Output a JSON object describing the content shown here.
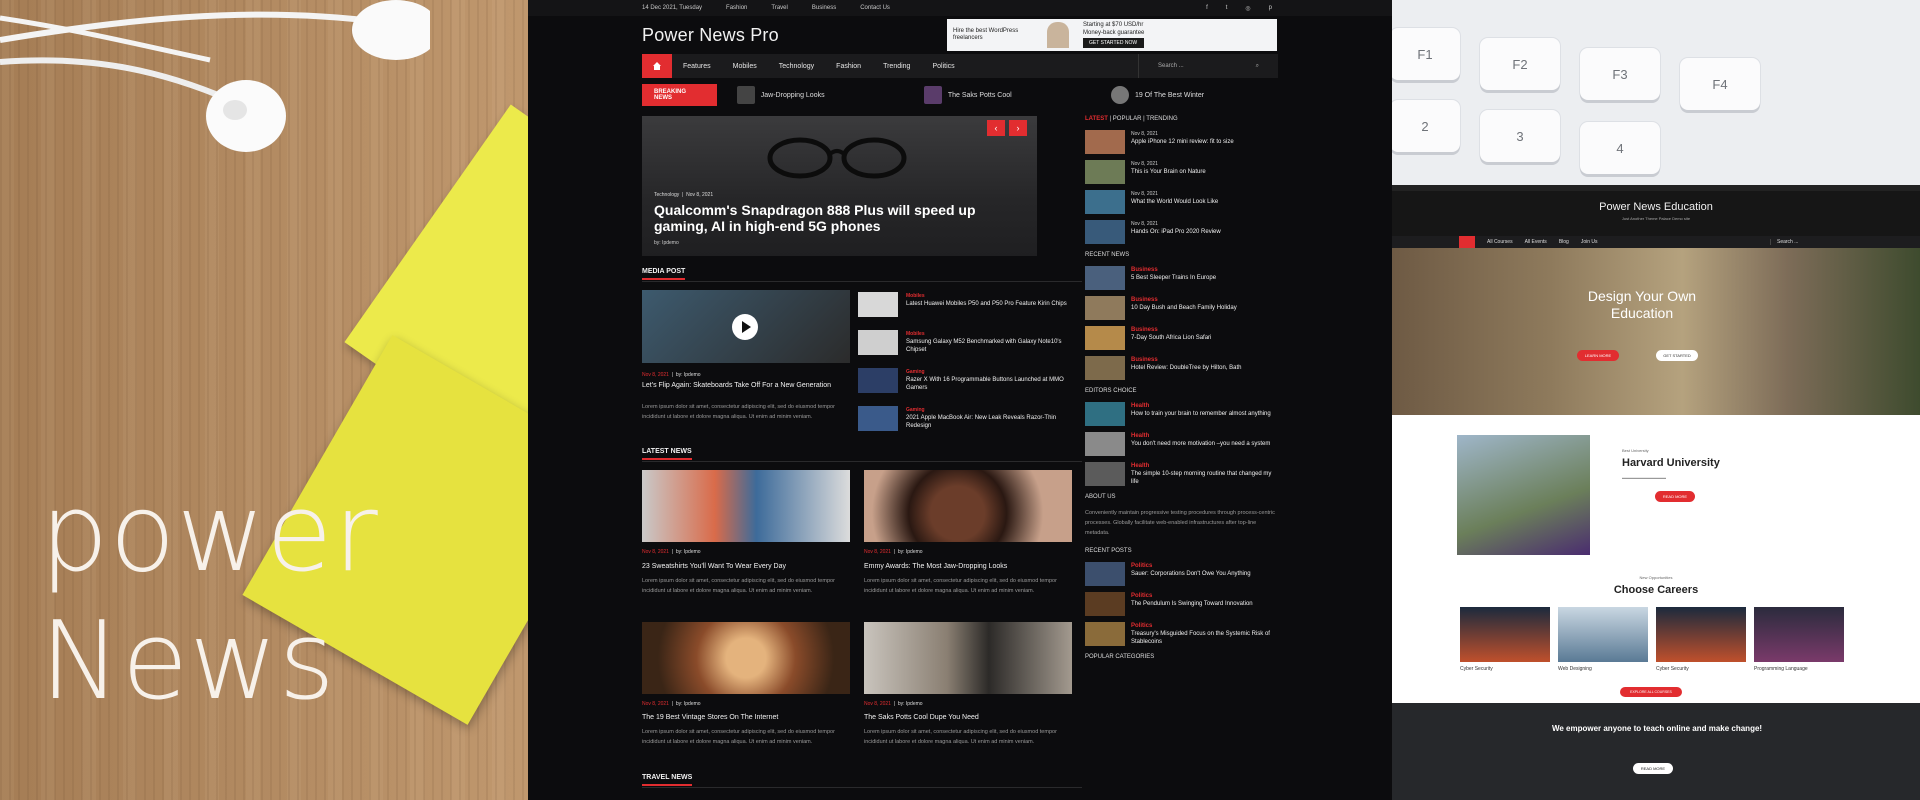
{
  "background": {
    "word1": "power",
    "word2": "News"
  },
  "keyboard": {
    "keys": [
      "F1",
      "F2",
      "F3",
      "F4",
      "2",
      "3",
      "4"
    ]
  },
  "main_site": {
    "topbar": {
      "date": "14 Dec 2021, Tuesday",
      "links": [
        "Fashion",
        "Travel",
        "Business",
        "Contact Us"
      ],
      "social_icons": [
        "facebook-icon",
        "twitter-icon",
        "instagram-icon",
        "pinterest-icon"
      ]
    },
    "logo": "Power News Pro",
    "ad": {
      "headline": "Hire the best WordPress freelancers",
      "rating": "Starting at $70 USD/hr",
      "guarantee": "Money-back guarantee",
      "button": "GET STARTED NOW"
    },
    "nav": {
      "items": [
        "Features",
        "Mobiles",
        "Technology",
        "Fashion",
        "Trending",
        "Politics"
      ],
      "search_placeholder": "Search ..."
    },
    "ticker": {
      "label": "BREAKING NEWS",
      "items": [
        "Jaw-Dropping Looks",
        "The Saks Potts Cool",
        "19 Of The Best Winter"
      ]
    },
    "hero": {
      "category": "Technology",
      "date": "Nov 8, 2021",
      "title": "Qualcomm's Snapdragon 888 Plus will speed up gaming, AI in high-end 5G phones",
      "author": "by: Ipdemo"
    },
    "sections": {
      "media": "MEDIA POST",
      "latest": "LATEST NEWS",
      "travel": "TRAVEL NEWS"
    },
    "media_post": {
      "main_date": "Nov 8, 2021",
      "main_author": "by: Ipdemo",
      "main_title": "Let's Flip Again: Skateboards Take Off For a New Generation",
      "lorem": "Lorem ipsum dolor sit amet, consectetur adipiscing elit, sed do eiusmod tempor incididunt ut labore et dolore magna aliqua. Ut enim ad minim veniam.",
      "list": [
        {
          "cat": "Mobiles",
          "title": "Latest Huawei Mobiles P50 and P50 Pro Feature Kirin Chips"
        },
        {
          "cat": "Mobiles",
          "title": "Samsung Galaxy M52 Benchmarked with Galaxy Note10's Chipset"
        },
        {
          "cat": "Gaming",
          "title": "Razer X With 16 Programmable Buttons Launched at MMO Gamers"
        },
        {
          "cat": "Gaming",
          "title": "2021 Apple MacBook Air: New Leak Reveals Razor-Thin Redesign"
        }
      ]
    },
    "latest_news": [
      {
        "date": "Nov 8, 2021",
        "author": "by: Ipdemo",
        "title": "23 Sweatshirts You'll Want To Wear Every Day"
      },
      {
        "date": "Nov 8, 2021",
        "author": "by: Ipdemo",
        "title": "Emmy Awards: The Most Jaw-Dropping Looks"
      },
      {
        "date": "Nov 8, 2021",
        "author": "by: Ipdemo",
        "title": "The 19 Best Vintage Stores On The Internet"
      },
      {
        "date": "Nov 8, 2021",
        "author": "by: Ipdemo",
        "title": "The Saks Potts Cool Dupe You Need"
      }
    ],
    "sidebar": {
      "tabs": [
        "LATEST",
        "POPULAR",
        "TRENDING"
      ],
      "latest": [
        {
          "date": "Nov 8, 2021",
          "title": "Apple iPhone 12 mini review: fit to size"
        },
        {
          "date": "Nov 8, 2021",
          "title": "This is Your Brain on Nature"
        },
        {
          "date": "Nov 8, 2021",
          "title": "What the World Would Look Like"
        },
        {
          "date": "Nov 8, 2021",
          "title": "Hands On: iPad Pro 2020 Review"
        }
      ],
      "recent_news_title": "RECENT NEWS",
      "recent_news": [
        {
          "cat": "Business",
          "title": "5 Best Sleeper Trains In Europe"
        },
        {
          "cat": "Business",
          "title": "10 Day Bush and Beach Family Holiday"
        },
        {
          "cat": "Business",
          "title": "7-Day South Africa Lion Safari"
        },
        {
          "cat": "Business",
          "title": "Hotel Review: DoubleTree by Hilton, Bath"
        }
      ],
      "editors_title": "EDITORS CHOICE",
      "editors": [
        {
          "cat": "Health",
          "title": "How to train your brain to remember almost anything"
        },
        {
          "cat": "Health",
          "title": "You don't need more motivation –you need a system"
        },
        {
          "cat": "Health",
          "title": "The simple 10-step morning routine that changed my life"
        }
      ],
      "about_title": "ABOUT US",
      "about_text": "Conveniently maintain progressive testing procedures through process-centric processes. Globally facilitate web-enabled infrastructures after top-line metadata.",
      "recent_posts_title": "RECENT POSTS",
      "recent_posts": [
        {
          "cat": "Politics",
          "title": "Sauer: Corporations Don't Owe You Anything"
        },
        {
          "cat": "Politics",
          "title": "The Pendulum Is Swinging Toward Innovation"
        },
        {
          "cat": "Politics",
          "title": "Treasury's Misguided Focus on the Systemic Risk of Stablecoins"
        }
      ],
      "popular_title": "POPULAR CATEGORIES"
    }
  },
  "edu_site": {
    "title": "Power News Education",
    "subtitle": "Just Another Theme Palace Demo site",
    "nav": [
      "All Courses",
      "All Events",
      "Blog",
      "Join Us"
    ],
    "search_placeholder": "Search ...",
    "hero_title": "Design Your Own Education",
    "hero_btn1": "LEARN MORE",
    "hero_btn2": "GET STARTED",
    "uni_small": "Best University",
    "uni_title": "Harvard University",
    "uni_btn": "READ MORE",
    "careers_small": "New Opportunities",
    "careers_title": "Choose Careers",
    "careers": [
      "Cyber Security",
      "Web Designing",
      "Cyber Security",
      "Programming Language"
    ],
    "careers_btn": "EXPLORE ALL COURSES",
    "footer_title": "We empower anyone to teach online and make change!",
    "footer_btn": "READ MORE"
  }
}
